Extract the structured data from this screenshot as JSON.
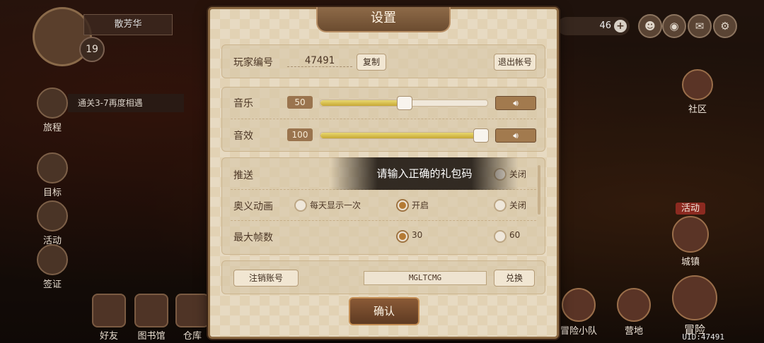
{
  "hud": {
    "player_name": "散芳华",
    "level": "19",
    "quest_text": "通关3-7再度相遇",
    "side": [
      "旅程",
      "目标",
      "活动",
      "签证"
    ],
    "bottom": [
      "好友",
      "图书馆",
      "仓库"
    ],
    "currency": "46",
    "right_buttons": [
      "社区",
      "活动",
      "城镇",
      "冒险小队",
      "营地",
      "冒险"
    ],
    "uid": "UID:47491"
  },
  "dialog": {
    "title": "设置",
    "player_id_label": "玩家编号",
    "player_id": "47491",
    "copy_label": "复制",
    "logout_label": "退出帐号",
    "music_label": "音乐",
    "music_value": "50",
    "music_level": 0.5,
    "sfx_label": "音效",
    "sfx_value": "100",
    "sfx_level": 1.0,
    "push_label": "推送",
    "push_off": "关闭",
    "anim_label": "奥义动画",
    "anim_once": "每天显示一次",
    "anim_on": "开启",
    "anim_off": "关闭",
    "fps_label": "最大帧数",
    "fps_30": "30",
    "fps_60": "60",
    "cancel_account": "注销账号",
    "gift_code": "MGLTCMG",
    "redeem": "兑换",
    "confirm": "确认",
    "toast": "请输入正确的礼包码"
  },
  "colors": {
    "accent": "#8d6b44",
    "panel": "#e2d2b4"
  }
}
